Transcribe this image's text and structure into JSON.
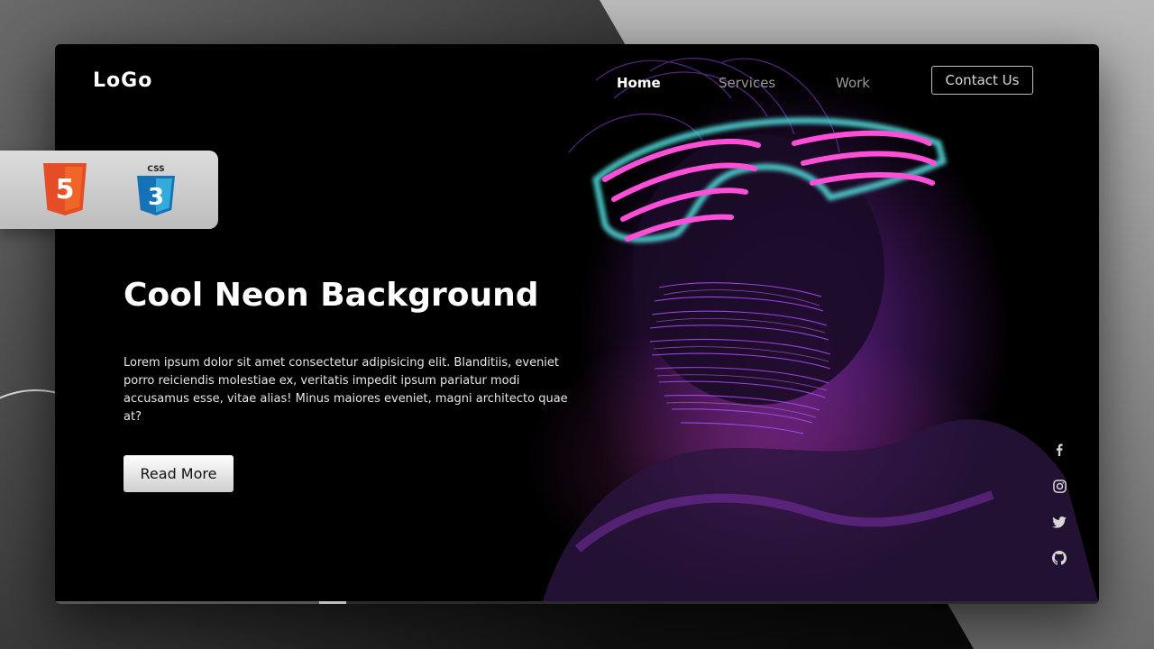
{
  "brand": {
    "logo": "LoGo"
  },
  "nav": {
    "items": [
      {
        "label": "Home",
        "active": true
      },
      {
        "label": "Services",
        "active": false
      },
      {
        "label": "Work",
        "active": false
      }
    ],
    "contact_label": "Contact Us"
  },
  "hero": {
    "title": "Cool Neon Background",
    "text": "Lorem ipsum dolor sit amet consectetur adipisicing elit. Blanditiis, eveniet porro reiciendis molestiae ex, veritatis impedit ipsum pariatur modi accusamus esse, vitae alias! Minus maiores eveniet, magni architecto quae at?",
    "button_label": "Read More"
  },
  "badge": {
    "html_text": "5",
    "css_caption": "CSS",
    "css_text": "3"
  },
  "social": [
    "facebook-icon",
    "instagram-icon",
    "twitter-icon",
    "github-icon"
  ],
  "colors": {
    "accent_pink": "#ff4fd8",
    "accent_cyan": "#4fd6d6",
    "neon_purple": "#b03cff",
    "html5_orange": "#e44d26",
    "css3_blue": "#1572b6"
  }
}
